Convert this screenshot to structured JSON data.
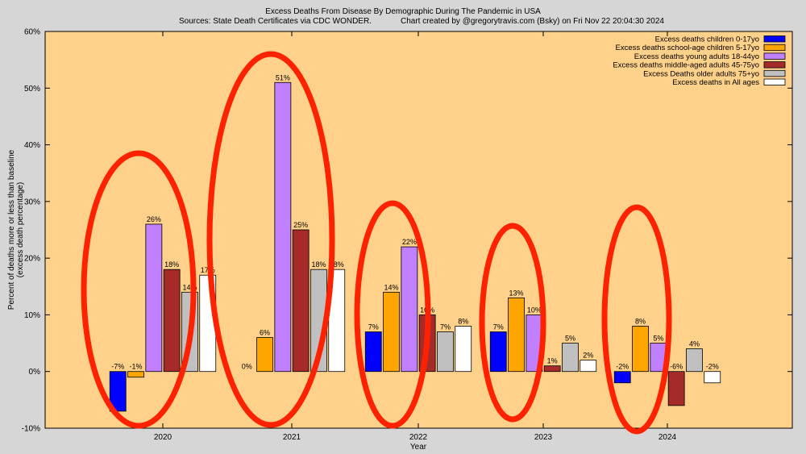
{
  "chart_data": {
    "type": "bar",
    "title": "Excess Deaths From Disease By Demographic During The Pandemic in USA",
    "subtitle_sources": "Sources: State Death Certificates via CDC WONDER.",
    "subtitle_credit": "Chart created by @gregorytravis.com (Bsky) on Fri Nov 22 20:04:30 2024",
    "xlabel": "Year",
    "ylabel_line1": "Percent of deaths more or less than baseline",
    "ylabel_line2": "(excess death percentage)",
    "ylim": [
      -10,
      60
    ],
    "yticks": [
      -10,
      0,
      10,
      20,
      30,
      40,
      50,
      60
    ],
    "ytick_labels": [
      "-10%",
      "0%",
      "10%",
      "20%",
      "30%",
      "40%",
      "50%",
      "60%"
    ],
    "categories": [
      "2020",
      "2021",
      "2022",
      "2023",
      "2024"
    ],
    "series": [
      {
        "name": "Excess deaths children 0-17yo",
        "color": "#0000ff",
        "values": [
          -7,
          0,
          7,
          7,
          -2
        ],
        "labels": [
          "-7%",
          "0%",
          "7%",
          "7%",
          "-2%"
        ]
      },
      {
        "name": "Excess deaths school-age children 5-17yo",
        "color": "#ffa500",
        "values": [
          -1,
          6,
          14,
          13,
          8
        ],
        "labels": [
          "-1%",
          "6%",
          "14%",
          "13%",
          "8%"
        ]
      },
      {
        "name": "Excess deaths young adults 18-44yo",
        "color": "#c080ff",
        "values": [
          26,
          51,
          22,
          10,
          5
        ],
        "labels": [
          "26%",
          "51%",
          "22%",
          "10%",
          "5%"
        ]
      },
      {
        "name": "Excess deaths middle-aged adults 45-75yo",
        "color": "#a52a2a",
        "values": [
          18,
          25,
          10,
          1,
          -6
        ],
        "labels": [
          "18%",
          "25%",
          "10%",
          "1%",
          "-6%"
        ]
      },
      {
        "name": "Excess Deaths older adults 75+yo",
        "color": "#c0c0c0",
        "values": [
          14,
          18,
          7,
          5,
          4
        ],
        "labels": [
          "14%",
          "18%",
          "7%",
          "5%",
          "4%"
        ]
      },
      {
        "name": "Excess deaths in All ages",
        "color": "#ffffff",
        "values": [
          17,
          18,
          8,
          2,
          -2
        ],
        "labels": [
          "17%",
          "18%",
          "8%",
          "2%",
          "-2%"
        ]
      }
    ],
    "legend_position": "top-right",
    "plot_background": "#ffd18a",
    "annotation_color": "#ff2200",
    "grid": false
  }
}
